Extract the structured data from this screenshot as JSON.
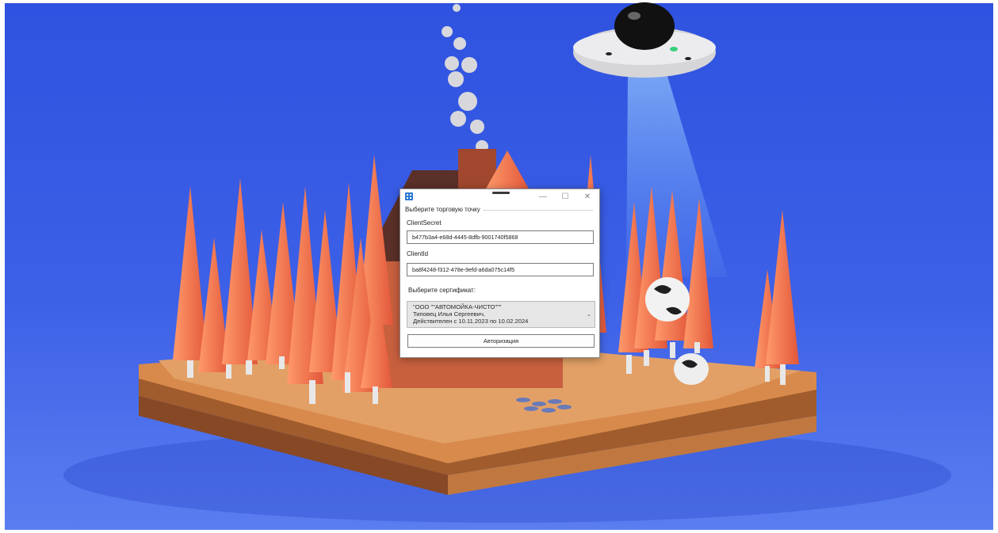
{
  "window": {
    "title": "",
    "controls": {
      "minimize_glyph": "—",
      "maximize_glyph": "☐",
      "close_glyph": "✕"
    },
    "icon": "app-icon"
  },
  "form": {
    "group_title": "Выберите торговую точку",
    "client_secret": {
      "label": "ClientSecret",
      "value": "b477b3a4-e68d-4445-8dfb-9001740f5868"
    },
    "client_id": {
      "label": "ClientId",
      "value": "ba8f4248-f312-478e-9efd-a6da075c14f5"
    },
    "certificate": {
      "label": "Выберите сертификат:",
      "selected_lines": [
        "\"ООО \"\"АВТОМОЙКА-ЧИСТО\"\"\"",
        "Типовец Илья Сергеевич,",
        "Действителен с 10.11.2023 по 10.02.2024"
      ],
      "arrow_glyph": "⌄"
    },
    "submit_label": "Авторизация"
  },
  "colors": {
    "sky": "#3a5ad8",
    "accent": "#2b79d6"
  }
}
